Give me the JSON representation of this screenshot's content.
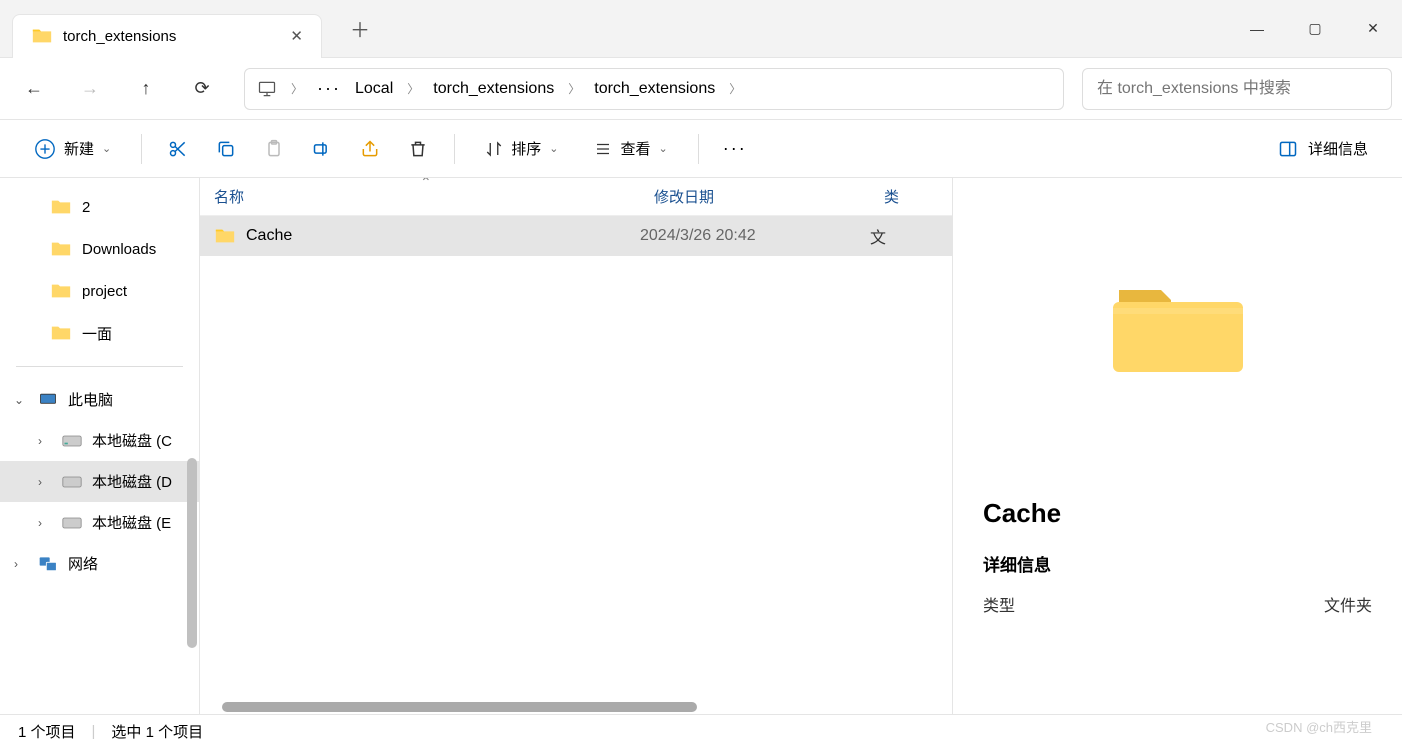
{
  "tab": {
    "title": "torch_extensions"
  },
  "breadcrumb": {
    "items": [
      "Local",
      "torch_extensions",
      "torch_extensions"
    ]
  },
  "search": {
    "placeholder": "在 torch_extensions 中搜索"
  },
  "toolbar": {
    "new": "新建",
    "sort": "排序",
    "view": "查看",
    "details": "详细信息"
  },
  "sidebar": {
    "quick": [
      "2",
      "Downloads",
      "project",
      "一面"
    ],
    "this_pc": "此电脑",
    "drives": [
      "本地磁盘 (C",
      "本地磁盘 (D",
      "本地磁盘 (E"
    ],
    "drive_selected": 1,
    "network": "网络"
  },
  "columns": {
    "name": "名称",
    "date": "修改日期",
    "type": "类"
  },
  "files": [
    {
      "name": "Cache",
      "date": "2024/3/26 20:42",
      "type": "文"
    }
  ],
  "preview": {
    "name": "Cache",
    "section": "详细信息",
    "type_label": "类型",
    "type_value": "文件夹"
  },
  "status": {
    "count": "1 个项目",
    "selected": "选中 1 个项目"
  },
  "watermark": "CSDN @ch西克里"
}
